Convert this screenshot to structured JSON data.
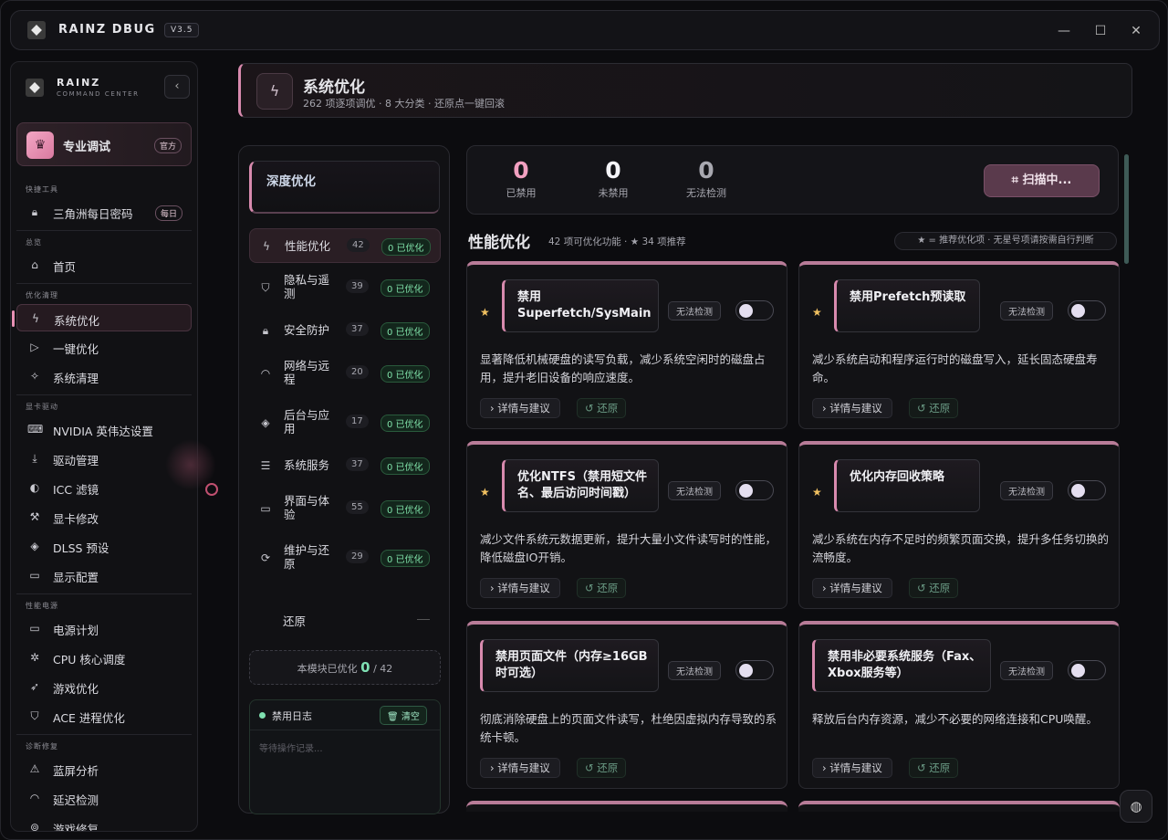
{
  "app": {
    "title": "RAINZ DBUG",
    "version": "V3.5"
  },
  "sidebar": {
    "brand": "RAINZ",
    "brand_sub": "COMMAND CENTER",
    "pro": {
      "label": "专业调试",
      "badge": "官方"
    },
    "sections": {
      "quick": "快捷工具",
      "overview": "总览",
      "optimize": "优化清理",
      "gpu": "显卡驱动",
      "power": "性能电源",
      "diagnose": "诊断修复"
    },
    "items": {
      "daily_code": "三角洲每日密码",
      "daily_badge": "每日",
      "home": "首页",
      "system_opt": "系统优化",
      "one_click": "一键优化",
      "system_clean": "系统清理",
      "nvidia": "NVIDIA 英伟达设置",
      "driver": "驱动管理",
      "icc": "ICC 滤镜",
      "gpu_mod": "显卡修改",
      "dlss": "DLSS 预设",
      "display": "显示配置",
      "power_plan": "电源计划",
      "cpu_sched": "CPU 核心调度",
      "game_opt": "游戏优化",
      "ace": "ACE 进程优化",
      "bsod": "蓝屏分析",
      "latency": "延迟检测",
      "game_fix": "游戏修复"
    }
  },
  "header": {
    "title": "系统优化",
    "subtitle": "262 项逐项调优 · 8 大分类 · 还原点一键回滚"
  },
  "categories": {
    "deep": "深度优化",
    "list": [
      {
        "label": "性能优化",
        "count": "42",
        "status": "0 已优化"
      },
      {
        "label": "隐私与遥测",
        "count": "39",
        "status": "0 已优化"
      },
      {
        "label": "安全防护",
        "count": "37",
        "status": "0 已优化"
      },
      {
        "label": "网络与远程",
        "count": "20",
        "status": "0 已优化"
      },
      {
        "label": "后台与应用",
        "count": "17",
        "status": "0 已优化"
      },
      {
        "label": "系统服务",
        "count": "37",
        "status": "0 已优化"
      },
      {
        "label": "界面与体验",
        "count": "55",
        "status": "0 已优化"
      },
      {
        "label": "维护与还原",
        "count": "29",
        "status": "0 已优化"
      }
    ],
    "restore": "还原",
    "summary": {
      "prefix": "本模块已优化",
      "done": "0",
      "total": "/ 42"
    },
    "log": {
      "title": "禁用日志",
      "clear": "清空",
      "empty": "等待操作记录..."
    }
  },
  "stats": {
    "disabled": {
      "value": "0",
      "label": "已禁用"
    },
    "enabled": {
      "value": "0",
      "label": "未禁用"
    },
    "unknown": {
      "value": "0",
      "label": "无法检测"
    },
    "scan": "扫描中..."
  },
  "section": {
    "title": "性能优化",
    "meta": "42 项可优化功能 · ★ 34 项推荐",
    "legend": "★ = 推荐优化项 · 无星号项请按需自行判断"
  },
  "card_common": {
    "status": "无法检测",
    "detail": "详情与建议",
    "restore": "还原"
  },
  "cards": [
    {
      "title": "禁用 Superfetch/SysMain",
      "desc": "显著降低机械硬盘的读写负载，减少系统空闲时的磁盘占用，提升老旧设备的响应速度。"
    },
    {
      "title": "禁用Prefetch预读取",
      "desc": "减少系统启动和程序运行时的磁盘写入，延长固态硬盘寿命。"
    },
    {
      "title": "优化NTFS（禁用短文件名、最后访问时间戳）",
      "desc": "减少文件系统元数据更新，提升大量小文件读写时的性能，降低磁盘IO开销。"
    },
    {
      "title": "优化内存回收策略",
      "desc": "减少系统在内存不足时的频繁页面交换，提升多任务切换的流畅度。"
    },
    {
      "title": "禁用页面文件（内存≥16GB时可选）",
      "desc": "彻底消除硬盘上的页面文件读写，杜绝因虚拟内存导致的系统卡顿。"
    },
    {
      "title": "禁用非必要系统服务（Fax、Xbox服务等）",
      "desc": "释放后台内存资源，减少不必要的网络连接和CPU唤醒。"
    }
  ]
}
